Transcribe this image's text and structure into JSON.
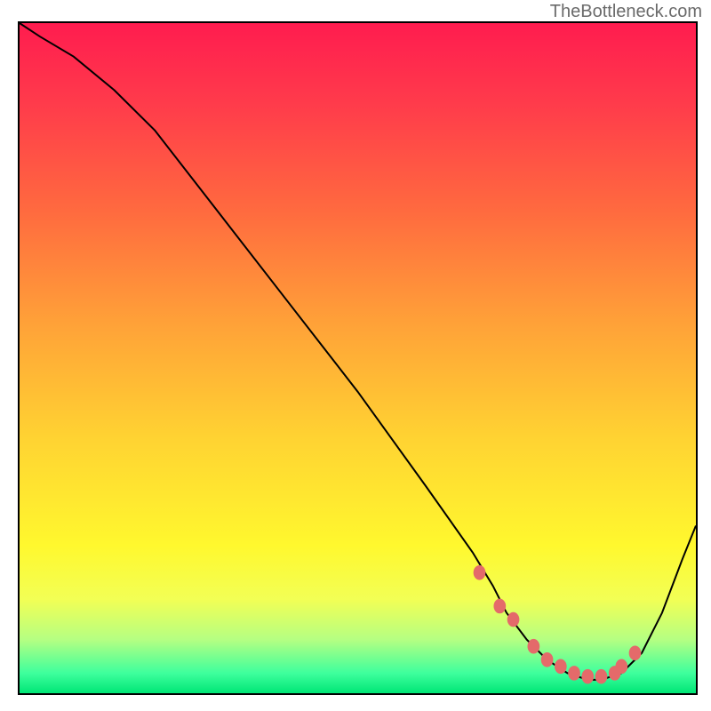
{
  "attribution": "TheBottleneck.com",
  "colors": {
    "curve": "#000000",
    "marker": "#e46a6a",
    "border": "#000000"
  },
  "chart_data": {
    "type": "line",
    "title": "",
    "xlabel": "",
    "ylabel": "",
    "xlim": [
      0,
      100
    ],
    "ylim": [
      0,
      100
    ],
    "grid": false,
    "legend": false,
    "series": [
      {
        "name": "curve",
        "x": [
          0,
          3,
          8,
          14,
          20,
          30,
          40,
          50,
          60,
          67,
          70,
          72,
          75,
          78,
          81,
          84,
          86,
          89,
          92,
          95,
          98,
          100
        ],
        "y": [
          100,
          98,
          95,
          90,
          84,
          71,
          58,
          45,
          31,
          21,
          16,
          12,
          8,
          5,
          3,
          2,
          2,
          3,
          6,
          12,
          20,
          25
        ]
      }
    ],
    "markers": {
      "name": "highlight-dots",
      "x": [
        68,
        71,
        73,
        76,
        78,
        80,
        82,
        84,
        86,
        88,
        89,
        91
      ],
      "y": [
        18,
        13,
        11,
        7,
        5,
        4,
        3,
        2.5,
        2.5,
        3,
        4,
        6
      ]
    }
  }
}
